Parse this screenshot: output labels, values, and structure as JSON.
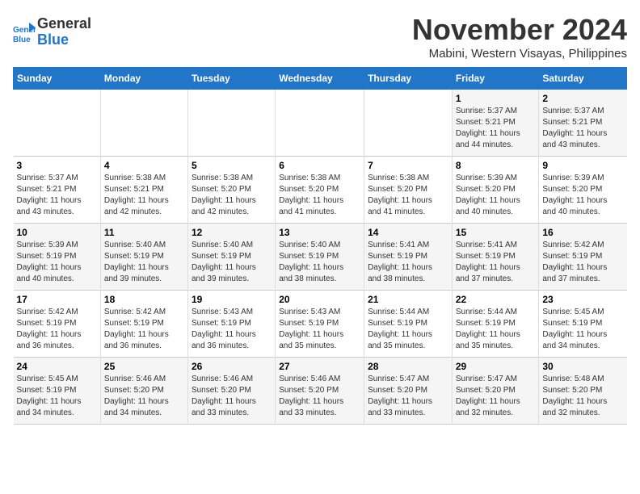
{
  "logo": {
    "line1": "General",
    "line2": "Blue"
  },
  "title": "November 2024",
  "subtitle": "Mabini, Western Visayas, Philippines",
  "days_of_week": [
    "Sunday",
    "Monday",
    "Tuesday",
    "Wednesday",
    "Thursday",
    "Friday",
    "Saturday"
  ],
  "weeks": [
    [
      {
        "day": "",
        "detail": ""
      },
      {
        "day": "",
        "detail": ""
      },
      {
        "day": "",
        "detail": ""
      },
      {
        "day": "",
        "detail": ""
      },
      {
        "day": "",
        "detail": ""
      },
      {
        "day": "1",
        "detail": "Sunrise: 5:37 AM\nSunset: 5:21 PM\nDaylight: 11 hours\nand 44 minutes."
      },
      {
        "day": "2",
        "detail": "Sunrise: 5:37 AM\nSunset: 5:21 PM\nDaylight: 11 hours\nand 43 minutes."
      }
    ],
    [
      {
        "day": "3",
        "detail": "Sunrise: 5:37 AM\nSunset: 5:21 PM\nDaylight: 11 hours\nand 43 minutes."
      },
      {
        "day": "4",
        "detail": "Sunrise: 5:38 AM\nSunset: 5:21 PM\nDaylight: 11 hours\nand 42 minutes."
      },
      {
        "day": "5",
        "detail": "Sunrise: 5:38 AM\nSunset: 5:20 PM\nDaylight: 11 hours\nand 42 minutes."
      },
      {
        "day": "6",
        "detail": "Sunrise: 5:38 AM\nSunset: 5:20 PM\nDaylight: 11 hours\nand 41 minutes."
      },
      {
        "day": "7",
        "detail": "Sunrise: 5:38 AM\nSunset: 5:20 PM\nDaylight: 11 hours\nand 41 minutes."
      },
      {
        "day": "8",
        "detail": "Sunrise: 5:39 AM\nSunset: 5:20 PM\nDaylight: 11 hours\nand 40 minutes."
      },
      {
        "day": "9",
        "detail": "Sunrise: 5:39 AM\nSunset: 5:20 PM\nDaylight: 11 hours\nand 40 minutes."
      }
    ],
    [
      {
        "day": "10",
        "detail": "Sunrise: 5:39 AM\nSunset: 5:19 PM\nDaylight: 11 hours\nand 40 minutes."
      },
      {
        "day": "11",
        "detail": "Sunrise: 5:40 AM\nSunset: 5:19 PM\nDaylight: 11 hours\nand 39 minutes."
      },
      {
        "day": "12",
        "detail": "Sunrise: 5:40 AM\nSunset: 5:19 PM\nDaylight: 11 hours\nand 39 minutes."
      },
      {
        "day": "13",
        "detail": "Sunrise: 5:40 AM\nSunset: 5:19 PM\nDaylight: 11 hours\nand 38 minutes."
      },
      {
        "day": "14",
        "detail": "Sunrise: 5:41 AM\nSunset: 5:19 PM\nDaylight: 11 hours\nand 38 minutes."
      },
      {
        "day": "15",
        "detail": "Sunrise: 5:41 AM\nSunset: 5:19 PM\nDaylight: 11 hours\nand 37 minutes."
      },
      {
        "day": "16",
        "detail": "Sunrise: 5:42 AM\nSunset: 5:19 PM\nDaylight: 11 hours\nand 37 minutes."
      }
    ],
    [
      {
        "day": "17",
        "detail": "Sunrise: 5:42 AM\nSunset: 5:19 PM\nDaylight: 11 hours\nand 36 minutes."
      },
      {
        "day": "18",
        "detail": "Sunrise: 5:42 AM\nSunset: 5:19 PM\nDaylight: 11 hours\nand 36 minutes."
      },
      {
        "day": "19",
        "detail": "Sunrise: 5:43 AM\nSunset: 5:19 PM\nDaylight: 11 hours\nand 36 minutes."
      },
      {
        "day": "20",
        "detail": "Sunrise: 5:43 AM\nSunset: 5:19 PM\nDaylight: 11 hours\nand 35 minutes."
      },
      {
        "day": "21",
        "detail": "Sunrise: 5:44 AM\nSunset: 5:19 PM\nDaylight: 11 hours\nand 35 minutes."
      },
      {
        "day": "22",
        "detail": "Sunrise: 5:44 AM\nSunset: 5:19 PM\nDaylight: 11 hours\nand 35 minutes."
      },
      {
        "day": "23",
        "detail": "Sunrise: 5:45 AM\nSunset: 5:19 PM\nDaylight: 11 hours\nand 34 minutes."
      }
    ],
    [
      {
        "day": "24",
        "detail": "Sunrise: 5:45 AM\nSunset: 5:19 PM\nDaylight: 11 hours\nand 34 minutes."
      },
      {
        "day": "25",
        "detail": "Sunrise: 5:46 AM\nSunset: 5:20 PM\nDaylight: 11 hours\nand 34 minutes."
      },
      {
        "day": "26",
        "detail": "Sunrise: 5:46 AM\nSunset: 5:20 PM\nDaylight: 11 hours\nand 33 minutes."
      },
      {
        "day": "27",
        "detail": "Sunrise: 5:46 AM\nSunset: 5:20 PM\nDaylight: 11 hours\nand 33 minutes."
      },
      {
        "day": "28",
        "detail": "Sunrise: 5:47 AM\nSunset: 5:20 PM\nDaylight: 11 hours\nand 33 minutes."
      },
      {
        "day": "29",
        "detail": "Sunrise: 5:47 AM\nSunset: 5:20 PM\nDaylight: 11 hours\nand 32 minutes."
      },
      {
        "day": "30",
        "detail": "Sunrise: 5:48 AM\nSunset: 5:20 PM\nDaylight: 11 hours\nand 32 minutes."
      }
    ]
  ]
}
